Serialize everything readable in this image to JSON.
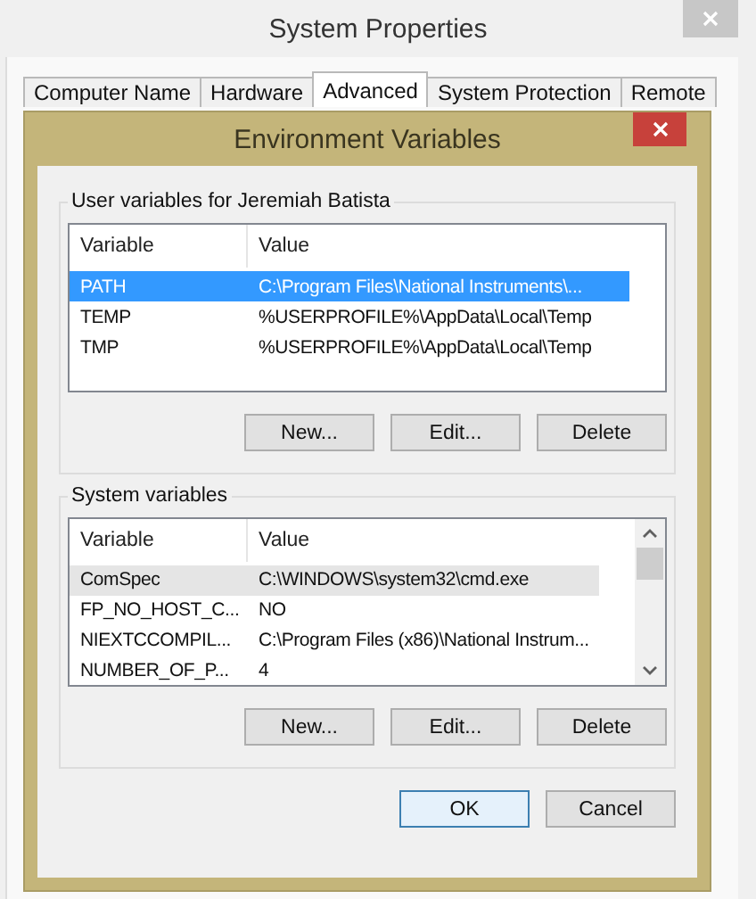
{
  "window": {
    "title": "System Properties"
  },
  "tabs": [
    {
      "label": "Computer Name",
      "selected": false
    },
    {
      "label": "Hardware",
      "selected": false
    },
    {
      "label": "Advanced",
      "selected": true
    },
    {
      "label": "System Protection",
      "selected": false
    },
    {
      "label": "Remote",
      "selected": false
    }
  ],
  "dialog": {
    "title": "Environment Variables",
    "groups": [
      {
        "title": "User variables for Jeremiah Batista",
        "focused": true,
        "scrollbar": false,
        "columns": [
          "Variable",
          "Value"
        ],
        "rows": [
          {
            "variable": "PATH",
            "value": "C:\\Program Files\\National Instruments\\...",
            "selected": true
          },
          {
            "variable": "TEMP",
            "value": "%USERPROFILE%\\AppData\\Local\\Temp",
            "selected": false
          },
          {
            "variable": "TMP",
            "value": "%USERPROFILE%\\AppData\\Local\\Temp",
            "selected": false
          }
        ],
        "buttons": [
          "New...",
          "Edit...",
          "Delete"
        ]
      },
      {
        "title": "System variables",
        "focused": false,
        "scrollbar": true,
        "columns": [
          "Variable",
          "Value"
        ],
        "rows": [
          {
            "variable": "ComSpec",
            "value": "C:\\WINDOWS\\system32\\cmd.exe",
            "selected": true
          },
          {
            "variable": "FP_NO_HOST_C...",
            "value": "NO",
            "selected": false
          },
          {
            "variable": "NIEXTCCOMPIL...",
            "value": "C:\\Program Files (x86)\\National Instrum...",
            "selected": false
          },
          {
            "variable": "NUMBER_OF_P...",
            "value": "4",
            "selected": false
          }
        ],
        "buttons": [
          "New...",
          "Edit...",
          "Delete"
        ]
      }
    ],
    "buttons": [
      {
        "label": "OK",
        "default": true
      },
      {
        "label": "Cancel",
        "default": false
      }
    ]
  }
}
